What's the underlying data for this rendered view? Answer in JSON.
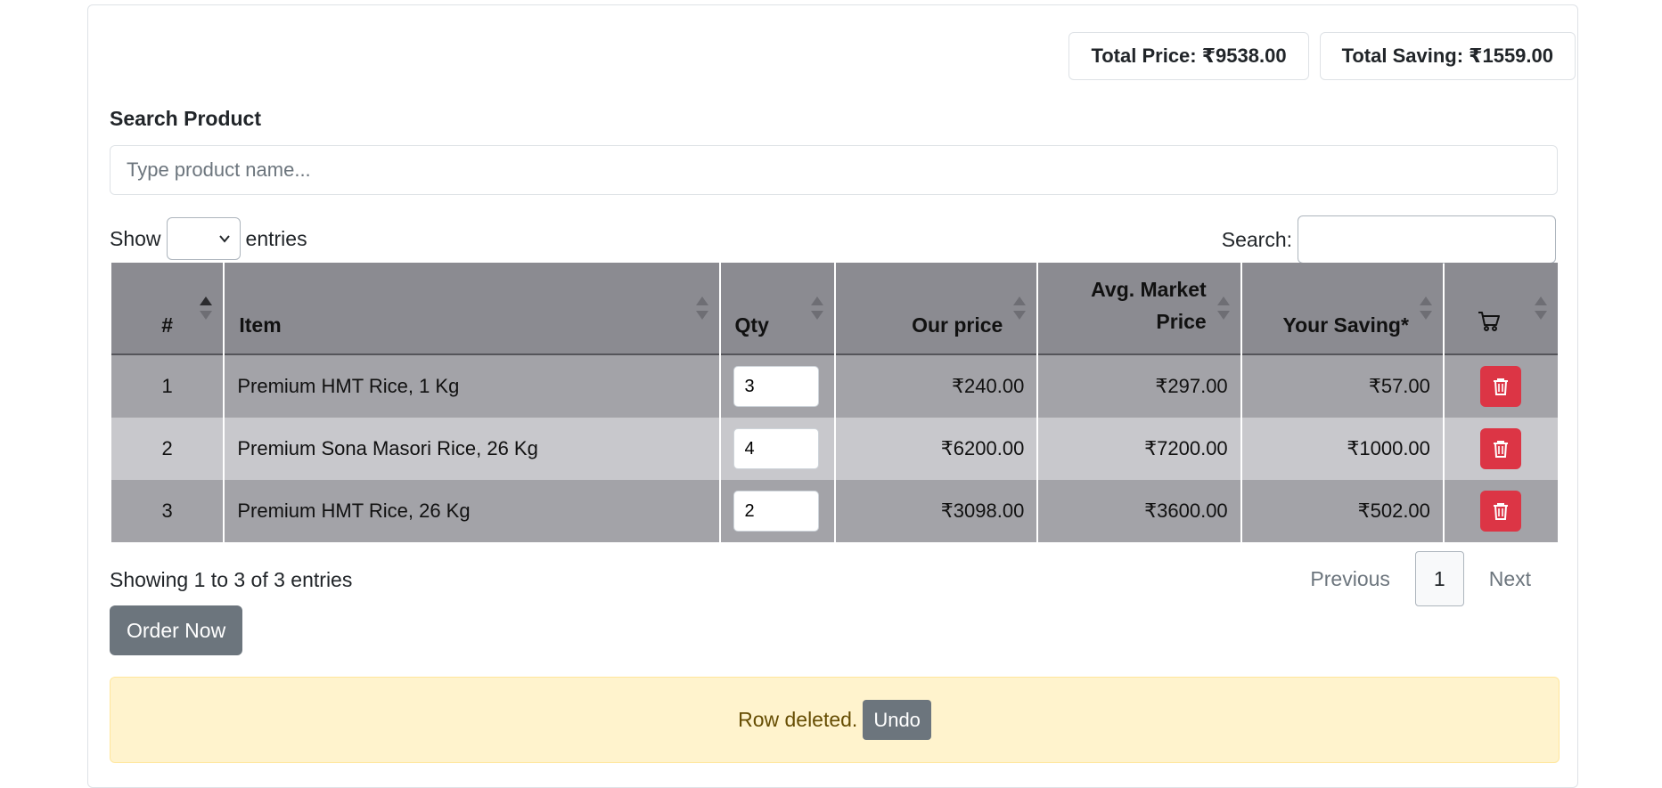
{
  "totals": {
    "price_label": "Total Price: ₹9538.00",
    "saving_label": "Total Saving: ₹1559.00"
  },
  "search_product": {
    "label": "Search Product",
    "placeholder": "Type product name..."
  },
  "length_menu": {
    "prefix": "Show",
    "suffix": "entries",
    "selected": ""
  },
  "filter": {
    "label": "Search:",
    "value": ""
  },
  "table": {
    "columns": [
      "#",
      "Item",
      "Qty",
      "Our price",
      "Avg. Market Price",
      "Your Saving*",
      "cart-icon"
    ],
    "rows": [
      {
        "num": "1",
        "item": "Premium HMT Rice, 1 Kg",
        "qty": "3",
        "our_price": "₹240.00",
        "market_price": "₹297.00",
        "saving": "₹57.00"
      },
      {
        "num": "2",
        "item": "Premium Sona Masori Rice, 26 Kg",
        "qty": "4",
        "our_price": "₹6200.00",
        "market_price": "₹7200.00",
        "saving": "₹1000.00"
      },
      {
        "num": "3",
        "item": "Premium HMT Rice, 26 Kg",
        "qty": "2",
        "our_price": "₹3098.00",
        "market_price": "₹3600.00",
        "saving": "₹502.00"
      }
    ]
  },
  "info": "Showing 1 to 3 of 3 entries",
  "pagination": {
    "previous": "Previous",
    "current": "1",
    "next": "Next"
  },
  "order_button": "Order Now",
  "alert": {
    "message": "Row deleted.",
    "undo": "Undo"
  },
  "colors": {
    "danger": "#dc3545",
    "secondary": "#6c757d",
    "alert_bg": "#fff3cd"
  }
}
